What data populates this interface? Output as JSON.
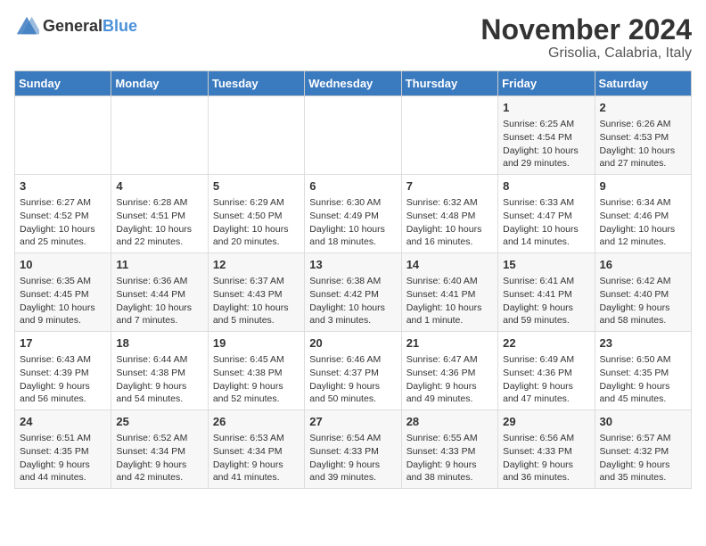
{
  "logo": {
    "general": "General",
    "blue": "Blue"
  },
  "title": "November 2024",
  "location": "Grisolia, Calabria, Italy",
  "days_of_week": [
    "Sunday",
    "Monday",
    "Tuesday",
    "Wednesday",
    "Thursday",
    "Friday",
    "Saturday"
  ],
  "weeks": [
    [
      {
        "day": "",
        "info": ""
      },
      {
        "day": "",
        "info": ""
      },
      {
        "day": "",
        "info": ""
      },
      {
        "day": "",
        "info": ""
      },
      {
        "day": "",
        "info": ""
      },
      {
        "day": "1",
        "info": "Sunrise: 6:25 AM\nSunset: 4:54 PM\nDaylight: 10 hours and 29 minutes."
      },
      {
        "day": "2",
        "info": "Sunrise: 6:26 AM\nSunset: 4:53 PM\nDaylight: 10 hours and 27 minutes."
      }
    ],
    [
      {
        "day": "3",
        "info": "Sunrise: 6:27 AM\nSunset: 4:52 PM\nDaylight: 10 hours and 25 minutes."
      },
      {
        "day": "4",
        "info": "Sunrise: 6:28 AM\nSunset: 4:51 PM\nDaylight: 10 hours and 22 minutes."
      },
      {
        "day": "5",
        "info": "Sunrise: 6:29 AM\nSunset: 4:50 PM\nDaylight: 10 hours and 20 minutes."
      },
      {
        "day": "6",
        "info": "Sunrise: 6:30 AM\nSunset: 4:49 PM\nDaylight: 10 hours and 18 minutes."
      },
      {
        "day": "7",
        "info": "Sunrise: 6:32 AM\nSunset: 4:48 PM\nDaylight: 10 hours and 16 minutes."
      },
      {
        "day": "8",
        "info": "Sunrise: 6:33 AM\nSunset: 4:47 PM\nDaylight: 10 hours and 14 minutes."
      },
      {
        "day": "9",
        "info": "Sunrise: 6:34 AM\nSunset: 4:46 PM\nDaylight: 10 hours and 12 minutes."
      }
    ],
    [
      {
        "day": "10",
        "info": "Sunrise: 6:35 AM\nSunset: 4:45 PM\nDaylight: 10 hours and 9 minutes."
      },
      {
        "day": "11",
        "info": "Sunrise: 6:36 AM\nSunset: 4:44 PM\nDaylight: 10 hours and 7 minutes."
      },
      {
        "day": "12",
        "info": "Sunrise: 6:37 AM\nSunset: 4:43 PM\nDaylight: 10 hours and 5 minutes."
      },
      {
        "day": "13",
        "info": "Sunrise: 6:38 AM\nSunset: 4:42 PM\nDaylight: 10 hours and 3 minutes."
      },
      {
        "day": "14",
        "info": "Sunrise: 6:40 AM\nSunset: 4:41 PM\nDaylight: 10 hours and 1 minute."
      },
      {
        "day": "15",
        "info": "Sunrise: 6:41 AM\nSunset: 4:41 PM\nDaylight: 9 hours and 59 minutes."
      },
      {
        "day": "16",
        "info": "Sunrise: 6:42 AM\nSunset: 4:40 PM\nDaylight: 9 hours and 58 minutes."
      }
    ],
    [
      {
        "day": "17",
        "info": "Sunrise: 6:43 AM\nSunset: 4:39 PM\nDaylight: 9 hours and 56 minutes."
      },
      {
        "day": "18",
        "info": "Sunrise: 6:44 AM\nSunset: 4:38 PM\nDaylight: 9 hours and 54 minutes."
      },
      {
        "day": "19",
        "info": "Sunrise: 6:45 AM\nSunset: 4:38 PM\nDaylight: 9 hours and 52 minutes."
      },
      {
        "day": "20",
        "info": "Sunrise: 6:46 AM\nSunset: 4:37 PM\nDaylight: 9 hours and 50 minutes."
      },
      {
        "day": "21",
        "info": "Sunrise: 6:47 AM\nSunset: 4:36 PM\nDaylight: 9 hours and 49 minutes."
      },
      {
        "day": "22",
        "info": "Sunrise: 6:49 AM\nSunset: 4:36 PM\nDaylight: 9 hours and 47 minutes."
      },
      {
        "day": "23",
        "info": "Sunrise: 6:50 AM\nSunset: 4:35 PM\nDaylight: 9 hours and 45 minutes."
      }
    ],
    [
      {
        "day": "24",
        "info": "Sunrise: 6:51 AM\nSunset: 4:35 PM\nDaylight: 9 hours and 44 minutes."
      },
      {
        "day": "25",
        "info": "Sunrise: 6:52 AM\nSunset: 4:34 PM\nDaylight: 9 hours and 42 minutes."
      },
      {
        "day": "26",
        "info": "Sunrise: 6:53 AM\nSunset: 4:34 PM\nDaylight: 9 hours and 41 minutes."
      },
      {
        "day": "27",
        "info": "Sunrise: 6:54 AM\nSunset: 4:33 PM\nDaylight: 9 hours and 39 minutes."
      },
      {
        "day": "28",
        "info": "Sunrise: 6:55 AM\nSunset: 4:33 PM\nDaylight: 9 hours and 38 minutes."
      },
      {
        "day": "29",
        "info": "Sunrise: 6:56 AM\nSunset: 4:33 PM\nDaylight: 9 hours and 36 minutes."
      },
      {
        "day": "30",
        "info": "Sunrise: 6:57 AM\nSunset: 4:32 PM\nDaylight: 9 hours and 35 minutes."
      }
    ]
  ]
}
